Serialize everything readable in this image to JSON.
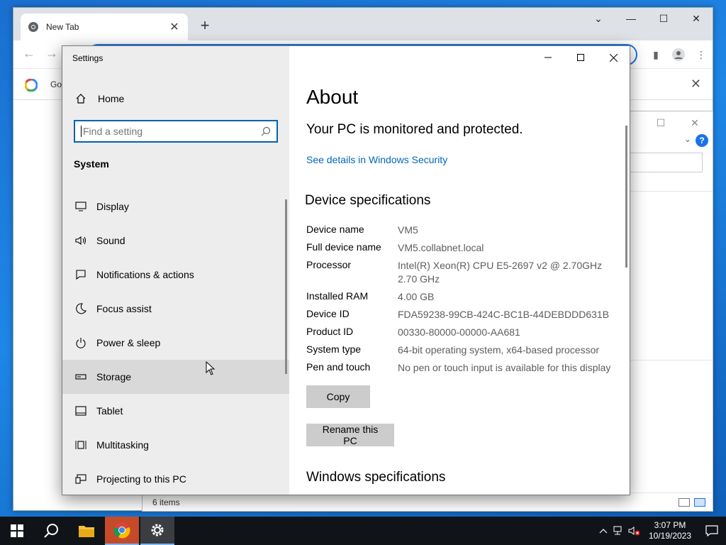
{
  "browser": {
    "tab_title": "New Tab",
    "tab_close": "✕",
    "new_tab": "+",
    "bookmark_text": "Go",
    "bookmarks_close": "✕"
  },
  "explorer": {
    "status_text": "6 items"
  },
  "settings": {
    "window_title": "Settings",
    "home_label": "Home",
    "search_placeholder": "Find a setting",
    "section_label": "System",
    "nav_items": [
      {
        "label": "Display",
        "icon": "display-icon"
      },
      {
        "label": "Sound",
        "icon": "sound-icon"
      },
      {
        "label": "Notifications & actions",
        "icon": "notifications-icon"
      },
      {
        "label": "Focus assist",
        "icon": "focus-assist-icon"
      },
      {
        "label": "Power & sleep",
        "icon": "power-icon"
      },
      {
        "label": "Storage",
        "icon": "storage-icon",
        "hovered": true
      },
      {
        "label": "Tablet",
        "icon": "tablet-icon"
      },
      {
        "label": "Multitasking",
        "icon": "multitasking-icon"
      },
      {
        "label": "Projecting to this PC",
        "icon": "projecting-icon"
      }
    ],
    "about": {
      "heading": "About",
      "protected_text": "Your PC is monitored and protected.",
      "security_link": "See details in Windows Security",
      "device_specs_heading": "Device specifications",
      "specs": [
        {
          "key": "Device name",
          "value": "VM5"
        },
        {
          "key": "Full device name",
          "value": "VM5.collabnet.local"
        },
        {
          "key": "Processor",
          "value": "Intel(R) Xeon(R) CPU E5-2697 v2 @ 2.70GHz 2.70 GHz"
        },
        {
          "key": "Installed RAM",
          "value": "4.00 GB"
        },
        {
          "key": "Device ID",
          "value": "FDA59238-99CB-424C-BC1B-44DEBDDD631B"
        },
        {
          "key": "Product ID",
          "value": "00330-80000-00000-AA681"
        },
        {
          "key": "System type",
          "value": "64-bit operating system, x64-based processor"
        },
        {
          "key": "Pen and touch",
          "value": "No pen or touch input is available for this display"
        }
      ],
      "copy_button": "Copy",
      "rename_button": "Rename this PC",
      "windows_specs_heading": "Windows specifications"
    }
  },
  "taskbar": {
    "time": "3:07 PM",
    "date": "10/19/2023"
  },
  "colors": {
    "accent": "#0063b1",
    "link": "#0067b8",
    "taskbar": "#101418"
  }
}
